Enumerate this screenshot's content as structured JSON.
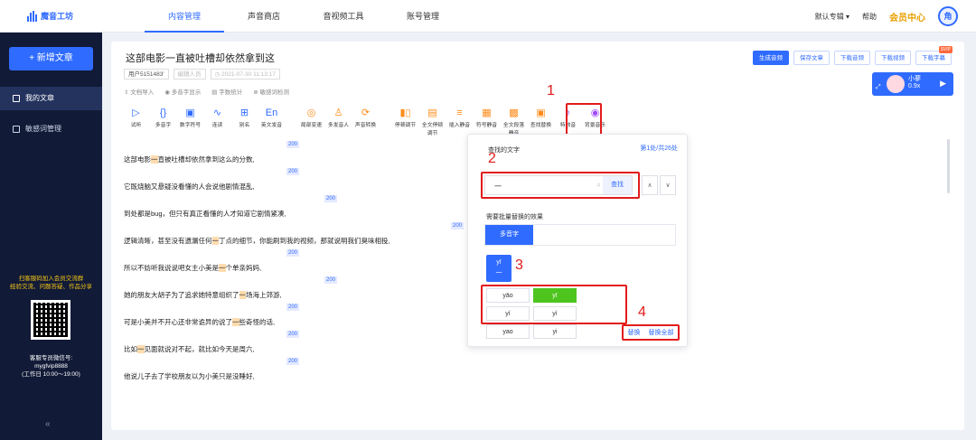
{
  "app": {
    "name": "魔音工坊"
  },
  "nav": {
    "tabs": [
      "内容管理",
      "声音商店",
      "音视频工具",
      "账号管理"
    ]
  },
  "topbar": {
    "album": "默认专辑",
    "help": "帮助",
    "vip": "会员中心",
    "avatar": "角"
  },
  "sidebar": {
    "new_article": "+ 新增文章",
    "items": [
      "我的文章",
      "敏感词管理"
    ],
    "promo": [
      "扫客服码加入会员交流群",
      "经验交流、问题答疑、作品分享"
    ],
    "cs": [
      "客服专员微信号:",
      "mygfvip8888",
      "(工作日 10:00～19:00)"
    ],
    "collapse": "«"
  },
  "doc": {
    "title": "这部电影一直被吐槽却依然拿到这",
    "user": "用户5151483'",
    "editor_placeholder": "编辑人员",
    "time": "2021-07-30 11:13:17",
    "subtools": [
      "文档导入",
      "多音字显示",
      "字数统计",
      "敏感词检测"
    ]
  },
  "actions": [
    "生成音频",
    "保存文章",
    "下载音频",
    "下载视频",
    "下载字幕"
  ],
  "svip": "SVIP",
  "voice": {
    "name": "小蓼",
    "speed": "0.9x"
  },
  "toolbar": [
    {
      "icon": "▷",
      "label": "试听"
    },
    {
      "icon": "{}",
      "label": "多音字"
    },
    {
      "icon": "▣",
      "label": "数字符号"
    },
    {
      "icon": "∿",
      "label": "连读"
    },
    {
      "icon": "⊞",
      "label": "别名"
    },
    {
      "icon": "En",
      "label": "英文发音"
    },
    {
      "icon": "◎",
      "label": "局部变速"
    },
    {
      "icon": "♙",
      "label": "多发音人"
    },
    {
      "icon": "⟳",
      "label": "声音转换"
    },
    {
      "icon": "▮▯",
      "label": "停顿调节"
    },
    {
      "icon": "▤",
      "label": "全文停顿调节"
    },
    {
      "icon": "≡",
      "label": "插入静音"
    },
    {
      "icon": "▦",
      "label": "符号静音"
    },
    {
      "icon": "▩",
      "label": "全文段落静音"
    },
    {
      "icon": "▣",
      "label": "查找替换"
    },
    {
      "icon": "♪",
      "label": "特效音"
    },
    {
      "icon": "◉",
      "label": "背景音乐"
    }
  ],
  "lines": [
    {
      "pre": "这部电影",
      "m": "一",
      "post": "直被吐槽却依然拿到这么的分数,"
    },
    {
      "pre": "它既烧脑又悬疑没看懂的人会说他剧情混乱,",
      "m": "",
      "post": ""
    },
    {
      "pre": "到处都是bug，但只有真正看懂的人才知道它剧情紧凑,",
      "m": "",
      "post": ""
    },
    {
      "pre": "逻辑清晰，甚至没有遗漏任何",
      "m": "一",
      "post": "丁点的细节，你能刷到我的视频，那就说明我们臭味相投,"
    },
    {
      "pre": "所以不妨听我说说吧女主小美是",
      "m": "一",
      "post": "个单亲妈妈,"
    },
    {
      "pre": "她的朋友大胡子为了追求她特意组织了",
      "m": "一",
      "post": "场海上郊游,"
    },
    {
      "pre": "可是小美并不开心还非常诡异的说了",
      "m": "一",
      "post": "些奇怪的话,"
    },
    {
      "pre": "比如",
      "m": "一",
      "post": "见面就说对不起，就比如今天是周六,"
    },
    {
      "pre": "他说儿子去了学校朋友以为小美只是没睡好,",
      "m": "",
      "post": ""
    }
  ],
  "tag": "200",
  "panel": {
    "find_label": "查找的文字",
    "count": "第1处/共26处",
    "value": "一",
    "search_btn": "查找",
    "up": "∧",
    "down": "∨",
    "batch_label": "需要批量替换的效果",
    "effect": "多音字",
    "current": [
      "yī",
      "一"
    ],
    "options": [
      "yāo",
      "yī",
      "yí",
      "yì",
      "yao",
      "yi"
    ],
    "replace": "替换",
    "replace_all": "替换全部"
  },
  "steps": [
    "1",
    "2",
    "3",
    "4"
  ]
}
